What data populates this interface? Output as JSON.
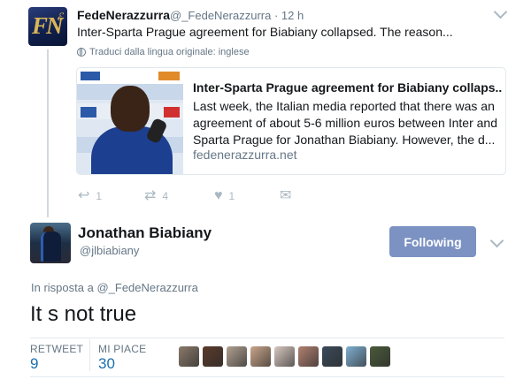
{
  "first_tweet": {
    "name": "FedeNerazzurra",
    "handle": "@_FedeNerazzurra",
    "time": "· 12 h",
    "text": "Inter-Sparta Prague agreement for Biabiany collapsed. The reason...",
    "translate_label": "Traduci dalla lingua originale: inglese",
    "avatar_text": "FN",
    "card": {
      "title": "Inter-Sparta Prague agreement for Biabiany collaps..",
      "description_lines": [
        "Last week, the Italian media reported that there was an",
        "agreement of about 5-6 million euros between Inter and",
        "Sparta Prague for Jonathan Biabiany. However, the d..."
      ],
      "domain": "fedenerazzurra.net"
    },
    "actions": {
      "reply_count": "1",
      "retweet_count": "4",
      "like_count": "1"
    }
  },
  "main_tweet": {
    "name": "Jonathan Biabiany",
    "handle": "@jlbiabiany",
    "follow_label": "Following",
    "reply_prefix": "In risposta a",
    "reply_handle": "@_FedeNerazzurra",
    "text": "It s not true",
    "stats": {
      "retweet_label": "RETWEET",
      "retweet_value": "9",
      "likes_label": "MI PIACE",
      "likes_value": "30"
    },
    "liker_colors": [
      "#8a7a6a",
      "#5a3a2a",
      "#b0a090",
      "#c9a58a",
      "#d8c8c0",
      "#b08070",
      "#3a4a5a",
      "#7fb0d0",
      "#4a5a3a"
    ]
  },
  "colors": {
    "follow_button": "#7b92c2",
    "stat_value": "#1b6fb0",
    "muted": "#657786"
  }
}
